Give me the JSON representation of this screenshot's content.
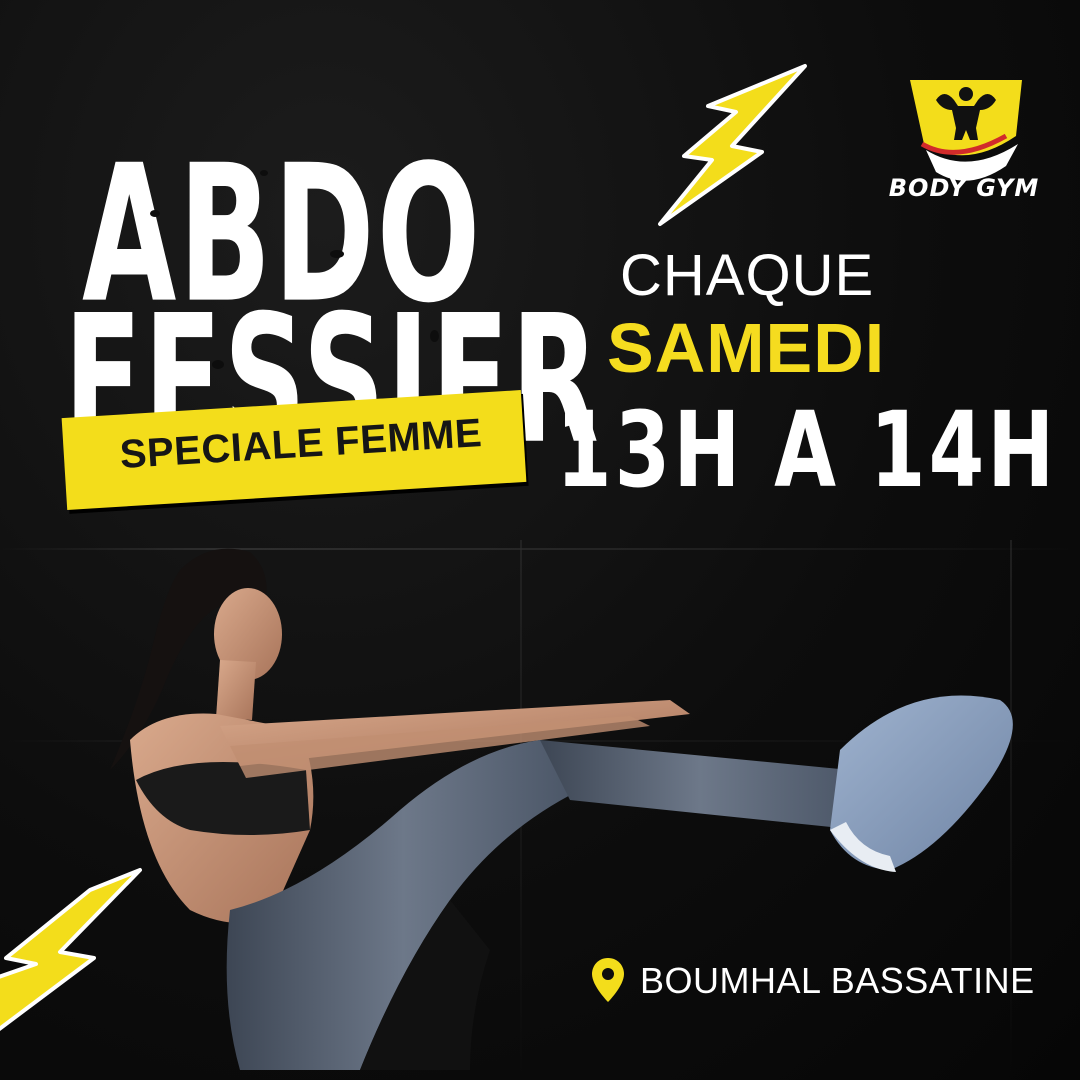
{
  "title": {
    "line1": "ABDO",
    "line2": "FESSIER",
    "badge": "SPECIALE FEMME"
  },
  "schedule": {
    "every": "CHAQUE",
    "day": "SAMEDI",
    "hours": "13H A 14H"
  },
  "brand": {
    "name": "BODY GYM",
    "logo_icon": "bodybuilder-shield-icon"
  },
  "location": {
    "icon": "map-pin-icon",
    "text": "BOUMHAL BASSATINE"
  },
  "colors": {
    "accent": "#f5dc1f",
    "background": "#0d0d0d",
    "text": "#ffffff"
  },
  "illustration": {
    "icon": "woman-doing-v-sit-crunch-illustration"
  }
}
